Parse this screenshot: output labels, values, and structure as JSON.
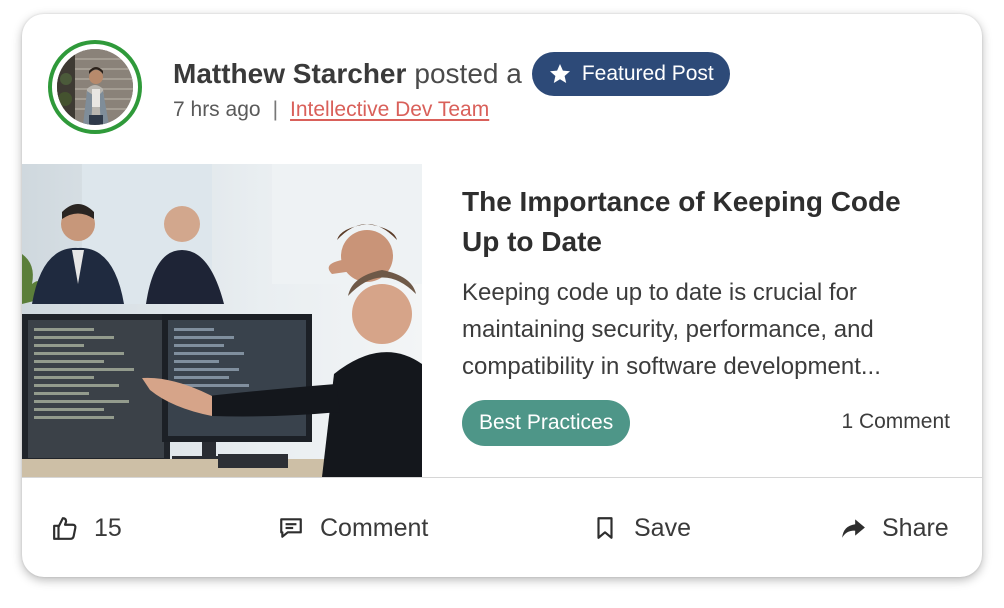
{
  "post": {
    "author_name": "Matthew Starcher",
    "action_text": "posted a",
    "featured_label": "Featured Post",
    "time_ago": "7 hrs ago",
    "separator": "|",
    "team_name": "Intellective Dev Team",
    "title": "The Importance of Keeping Code Up to Date",
    "excerpt": "Keeping code up to date is crucial for maintaining security, performance, and compatibility in software development...",
    "tag": "Best Practices",
    "comment_count": "1 Comment"
  },
  "actions": {
    "like_count": "15",
    "comment_label": "Comment",
    "save_label": "Save",
    "share_label": "Share"
  },
  "icons": {
    "featured": "star-icon",
    "like": "thumbs-up-icon",
    "comment": "comment-bubble-icon",
    "save": "bookmark-icon",
    "share": "share-arrow-icon"
  },
  "colors": {
    "avatar_ring": "#2f9a3a",
    "featured_badge": "#2d4a78",
    "team_link": "#d9605a",
    "tag_chip": "#4e9688"
  }
}
